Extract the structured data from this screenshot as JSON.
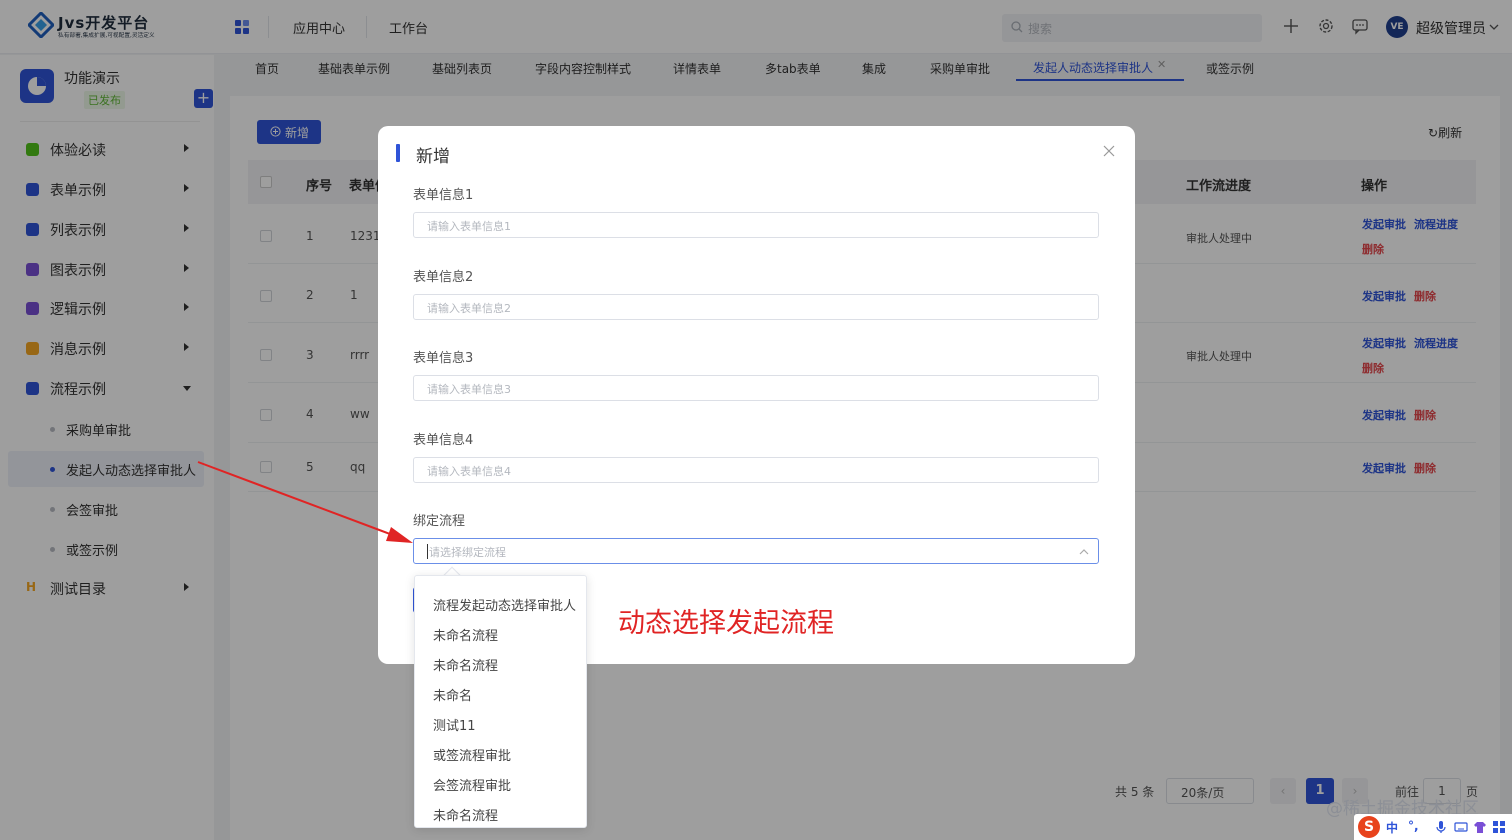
{
  "platform": {
    "title": "Jvs开发平台",
    "subtitle": "私有部署,集成扩展,可视配置,灵活定义"
  },
  "topnav": {
    "items": [
      "应用中心",
      "工作台"
    ],
    "search_placeholder": "搜索",
    "user_name": "超级管理员",
    "avatar_text": "VE"
  },
  "app": {
    "name": "功能演示",
    "status": "已发布",
    "add_label": "+"
  },
  "sidebar": {
    "items": [
      {
        "label": "体验必读",
        "icon_color": "#52c41a"
      },
      {
        "label": "表单示例",
        "icon_color": "#2f54d8"
      },
      {
        "label": "列表示例",
        "icon_color": "#2f54d8"
      },
      {
        "label": "图表示例",
        "icon_color": "#7a4fd6"
      },
      {
        "label": "逻辑示例",
        "icon_color": "#7a4fd6"
      },
      {
        "label": "消息示例",
        "icon_color": "#f5a623"
      },
      {
        "label": "流程示例",
        "icon_color": "#2f54d8"
      }
    ],
    "sub_items": [
      "采购单审批",
      "发起人动态选择审批人",
      "会签审批",
      "或签示例"
    ],
    "extra_item": {
      "label": "测试目录",
      "icon_color": "#f5a623",
      "icon_text": "H"
    }
  },
  "tabs": [
    "首页",
    "基础表单示例",
    "基础列表页",
    "字段内容控制样式",
    "详情表单",
    "多tab表单",
    "集成",
    "采购单审批",
    "发起人动态选择审批人",
    "或签示例"
  ],
  "toolbar": {
    "new_label": "新增",
    "refresh_label": "刷新"
  },
  "table": {
    "headers": {
      "index": "序号",
      "form": "表单信",
      "progress": "工作流进度",
      "actions": "操作"
    },
    "rows": [
      {
        "index": "1",
        "form": "1231:",
        "progress": "审批人处理中",
        "a1": "发起审批",
        "a2": "流程进度",
        "a3": "删除"
      },
      {
        "index": "2",
        "form": "1",
        "progress": "",
        "a1": "发起审批",
        "a2": "",
        "a3": "删除"
      },
      {
        "index": "3",
        "form": "rrrr",
        "progress": "审批人处理中",
        "a1": "发起审批",
        "a2": "流程进度",
        "a3": "删除"
      },
      {
        "index": "4",
        "form": "ww",
        "progress": "",
        "a1": "发起审批",
        "a2": "",
        "a3": "删除"
      },
      {
        "index": "5",
        "form": "qq",
        "progress": "",
        "a1": "发起审批",
        "a2": "",
        "a3": "删除"
      }
    ]
  },
  "pager": {
    "total": "共 5 条",
    "size": "20条/页",
    "current": "1",
    "goto": "前往",
    "goto_value": "1",
    "page_suffix": "页"
  },
  "dialog": {
    "title": "新增",
    "fields": [
      {
        "label": "表单信息1",
        "placeholder": "请输入表单信息1"
      },
      {
        "label": "表单信息2",
        "placeholder": "请输入表单信息2"
      },
      {
        "label": "表单信息3",
        "placeholder": "请输入表单信息3"
      },
      {
        "label": "表单信息4",
        "placeholder": "请输入表单信息4"
      }
    ],
    "flow_label": "绑定流程",
    "flow_placeholder": "请选择绑定流程",
    "annotation": "动态选择发起流程"
  },
  "dropdown": {
    "options": [
      "流程发起动态选择审批人",
      "未命名流程",
      "未命名流程",
      "未命名",
      "测试11",
      "或签流程审批",
      "会签流程审批",
      "未命名流程"
    ]
  },
  "watermark": "@稀土掘金技术社区",
  "ime": {
    "logo": "S",
    "lang": "中",
    "punct": "°,"
  },
  "colors": {
    "primary": "#2f54d8",
    "danger": "#e5484d",
    "annotation": "#e02424",
    "success": "#5fb836"
  }
}
